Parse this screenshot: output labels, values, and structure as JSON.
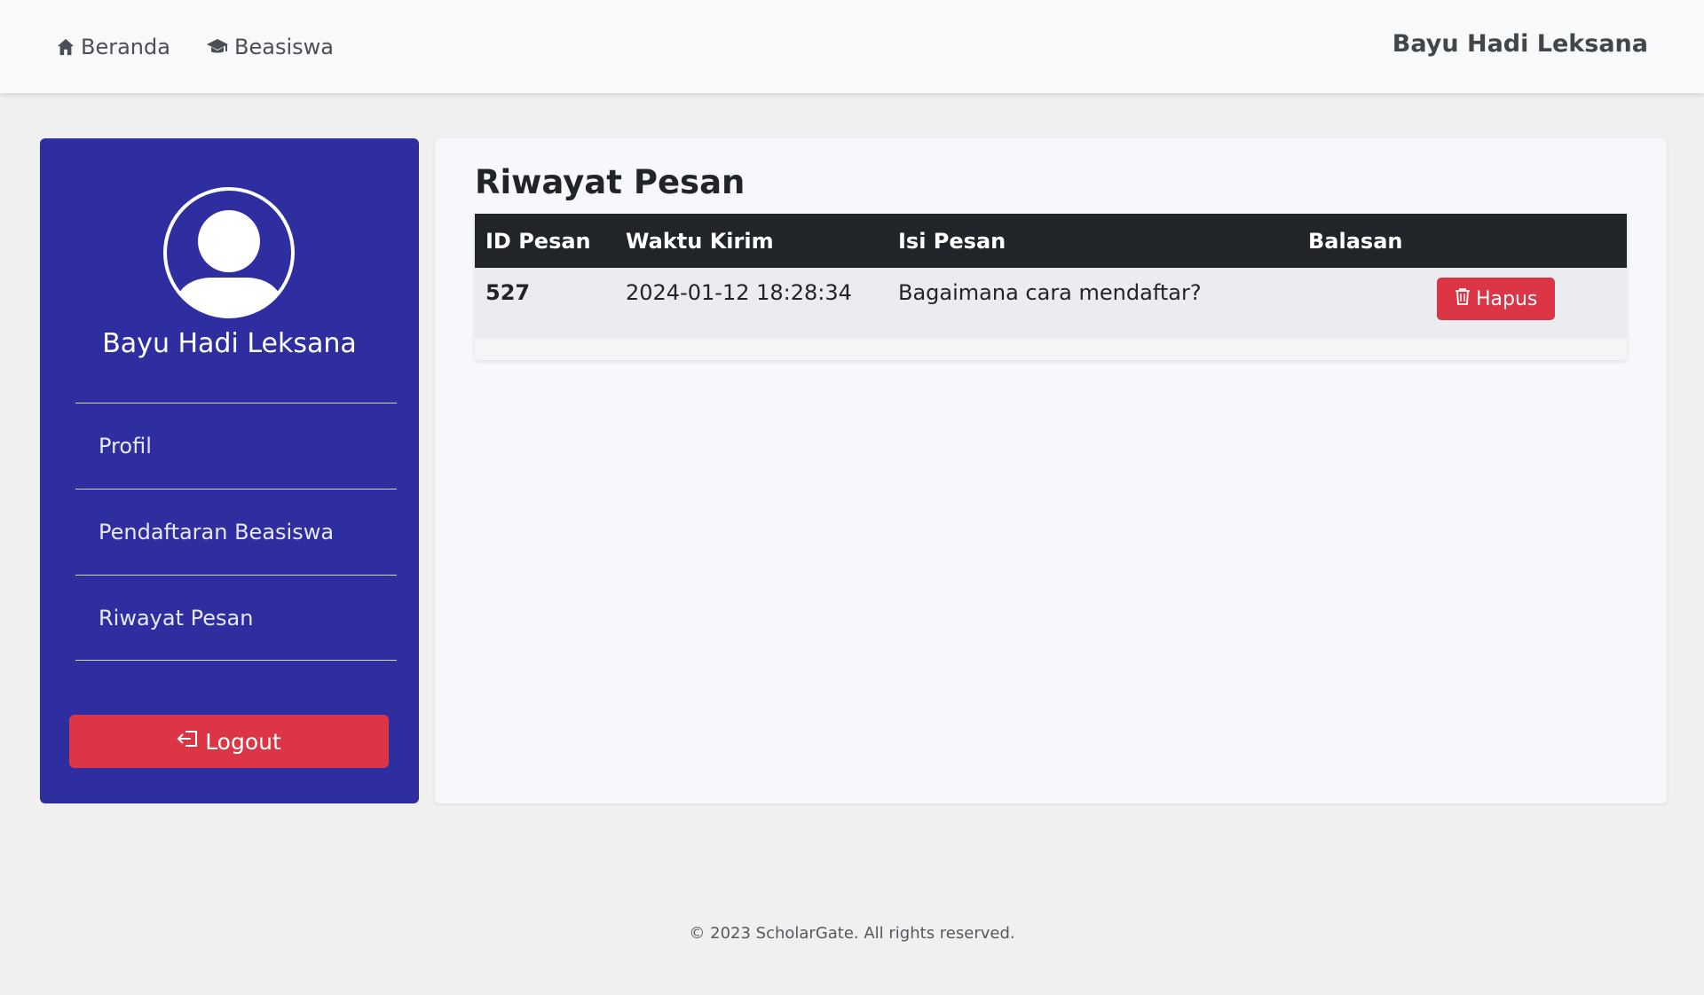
{
  "nav": {
    "home_label": "Beranda",
    "scholarship_label": "Beasiswa",
    "user_name": "Bayu Hadi Leksana"
  },
  "sidebar": {
    "user_name": "Bayu Hadi Leksana",
    "items": [
      {
        "label": "Profil"
      },
      {
        "label": "Pendaftaran Beasiswa"
      },
      {
        "label": "Riwayat Pesan"
      }
    ],
    "logout_label": "Logout"
  },
  "main": {
    "title": "Riwayat Pesan",
    "table": {
      "headers": [
        "ID Pesan",
        "Waktu Kirim",
        "Isi Pesan",
        "Balasan"
      ],
      "rows": [
        {
          "id": "527",
          "time": "2024-01-12 18:28:34",
          "message": "Bagaimana cara mendaftar?",
          "reply": "",
          "action_label": "Hapus"
        }
      ]
    }
  },
  "footer": {
    "text": "© 2023 ScholarGate. All rights reserved."
  },
  "colors": {
    "sidebar_bg": "#2e2ea0",
    "danger": "#dc3545",
    "table_header_bg": "#212529",
    "page_bg": "#f0f0f0"
  },
  "icons": {
    "home": "home-icon",
    "scholarship": "graduation-cap-icon",
    "avatar": "user-avatar-icon",
    "logout": "logout-icon",
    "delete": "trash-icon"
  }
}
